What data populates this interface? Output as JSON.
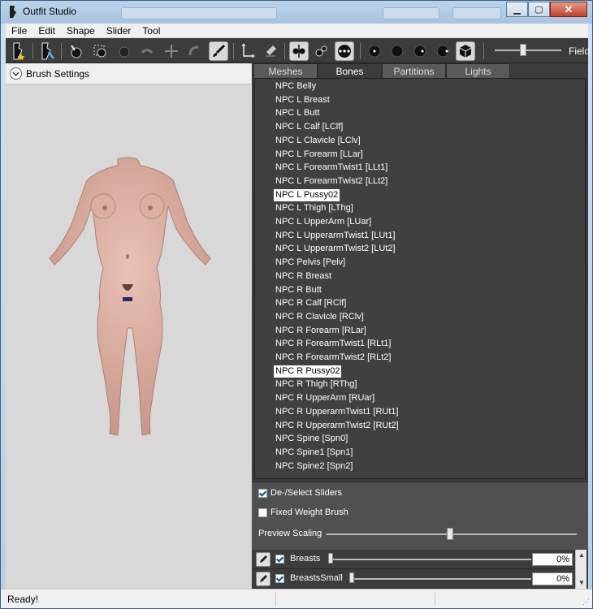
{
  "window": {
    "title": "Outfit Studio"
  },
  "menubar": [
    "File",
    "Edit",
    "Shape",
    "Slider",
    "Tool"
  ],
  "toolbar": {
    "field_label": "Field"
  },
  "left_panel": {
    "brush_settings_label": "Brush Settings"
  },
  "tabs": [
    {
      "label": "Meshes",
      "active": false
    },
    {
      "label": "Bones",
      "active": true
    },
    {
      "label": "Partitions",
      "active": false
    },
    {
      "label": "Lights",
      "active": false
    }
  ],
  "bones": [
    {
      "label": "NPC Belly",
      "selected": false
    },
    {
      "label": "NPC L Breast",
      "selected": false
    },
    {
      "label": "NPC L Butt",
      "selected": false
    },
    {
      "label": "NPC L Calf [LClf]",
      "selected": false
    },
    {
      "label": "NPC L Clavicle [LClv]",
      "selected": false
    },
    {
      "label": "NPC L Forearm [LLar]",
      "selected": false
    },
    {
      "label": "NPC L ForearmTwist1 [LLt1]",
      "selected": false
    },
    {
      "label": "NPC L ForearmTwist2 [LLt2]",
      "selected": false
    },
    {
      "label": "NPC L Pussy02",
      "selected": true
    },
    {
      "label": "NPC L Thigh [LThg]",
      "selected": false
    },
    {
      "label": "NPC L UpperArm [LUar]",
      "selected": false
    },
    {
      "label": "NPC L UpperarmTwist1 [LUt1]",
      "selected": false
    },
    {
      "label": "NPC L UpperarmTwist2 [LUt2]",
      "selected": false
    },
    {
      "label": "NPC Pelvis [Pelv]",
      "selected": false
    },
    {
      "label": "NPC R Breast",
      "selected": false
    },
    {
      "label": "NPC R Butt",
      "selected": false
    },
    {
      "label": "NPC R Calf [RClf]",
      "selected": false
    },
    {
      "label": "NPC R Clavicle [RClv]",
      "selected": false
    },
    {
      "label": "NPC R Forearm [RLar]",
      "selected": false
    },
    {
      "label": "NPC R ForearmTwist1 [RLt1]",
      "selected": false
    },
    {
      "label": "NPC R ForearmTwist2 [RLt2]",
      "selected": false
    },
    {
      "label": "NPC R Pussy02",
      "selected": true
    },
    {
      "label": "NPC R Thigh [RThg]",
      "selected": false
    },
    {
      "label": "NPC R UpperArm [RUar]",
      "selected": false
    },
    {
      "label": "NPC R UpperarmTwist1 [RUt1]",
      "selected": false
    },
    {
      "label": "NPC R UpperarmTwist2 [RUt2]",
      "selected": false
    },
    {
      "label": "NPC Spine [Spn0]",
      "selected": false
    },
    {
      "label": "NPC Spine1 [Spn1]",
      "selected": false
    },
    {
      "label": "NPC Spine2 [Spn2]",
      "selected": false
    }
  ],
  "options": {
    "deselect_sliders": {
      "label": "De-/Select Sliders",
      "checked": true
    },
    "fixed_weight_brush": {
      "label": "Fixed Weight Brush",
      "checked": false
    },
    "preview_scaling": {
      "label": "Preview Scaling",
      "level": 0.5
    }
  },
  "sliders": [
    {
      "name": "Breasts",
      "checked": true,
      "value": "0%",
      "level": 0
    },
    {
      "name": "BreastsSmall",
      "checked": true,
      "value": "0%",
      "level": 0
    }
  ],
  "status": {
    "text": "Ready!"
  },
  "colors": {
    "panel_dark": "#3c3c3c",
    "list_bg": "#404040",
    "viewport": "#d8d8d8",
    "skin": "#d9aa9a"
  }
}
